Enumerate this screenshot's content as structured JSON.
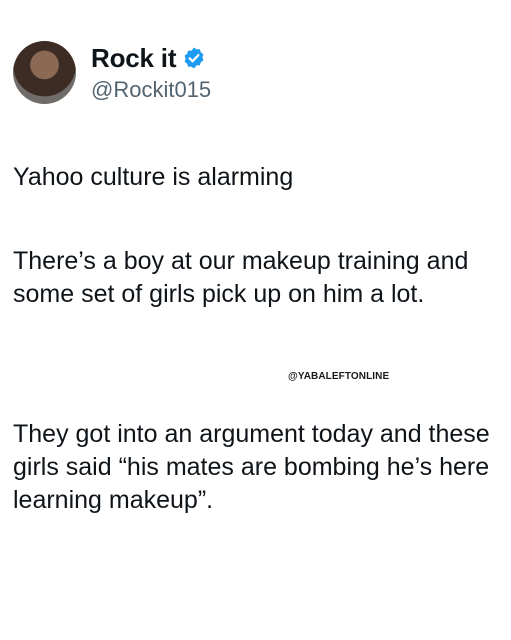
{
  "tweet": {
    "display_name": "Rock it",
    "handle": "@Rockit015",
    "paragraphs": [
      "Yahoo culture is alarming",
      "There’s a boy at our makeup training and some set of girls pick up on him a lot.",
      "They got into an argument today and these girls said “his mates are bombing he’s here learning makeup”."
    ]
  },
  "watermark": "@YABALEFTONLINE",
  "colors": {
    "text": "#0f1419",
    "secondary": "#536471",
    "verified_blue": "#1d9bf0"
  },
  "icons": {
    "verified": "verified-badge-icon",
    "avatar": "profile-photo"
  }
}
